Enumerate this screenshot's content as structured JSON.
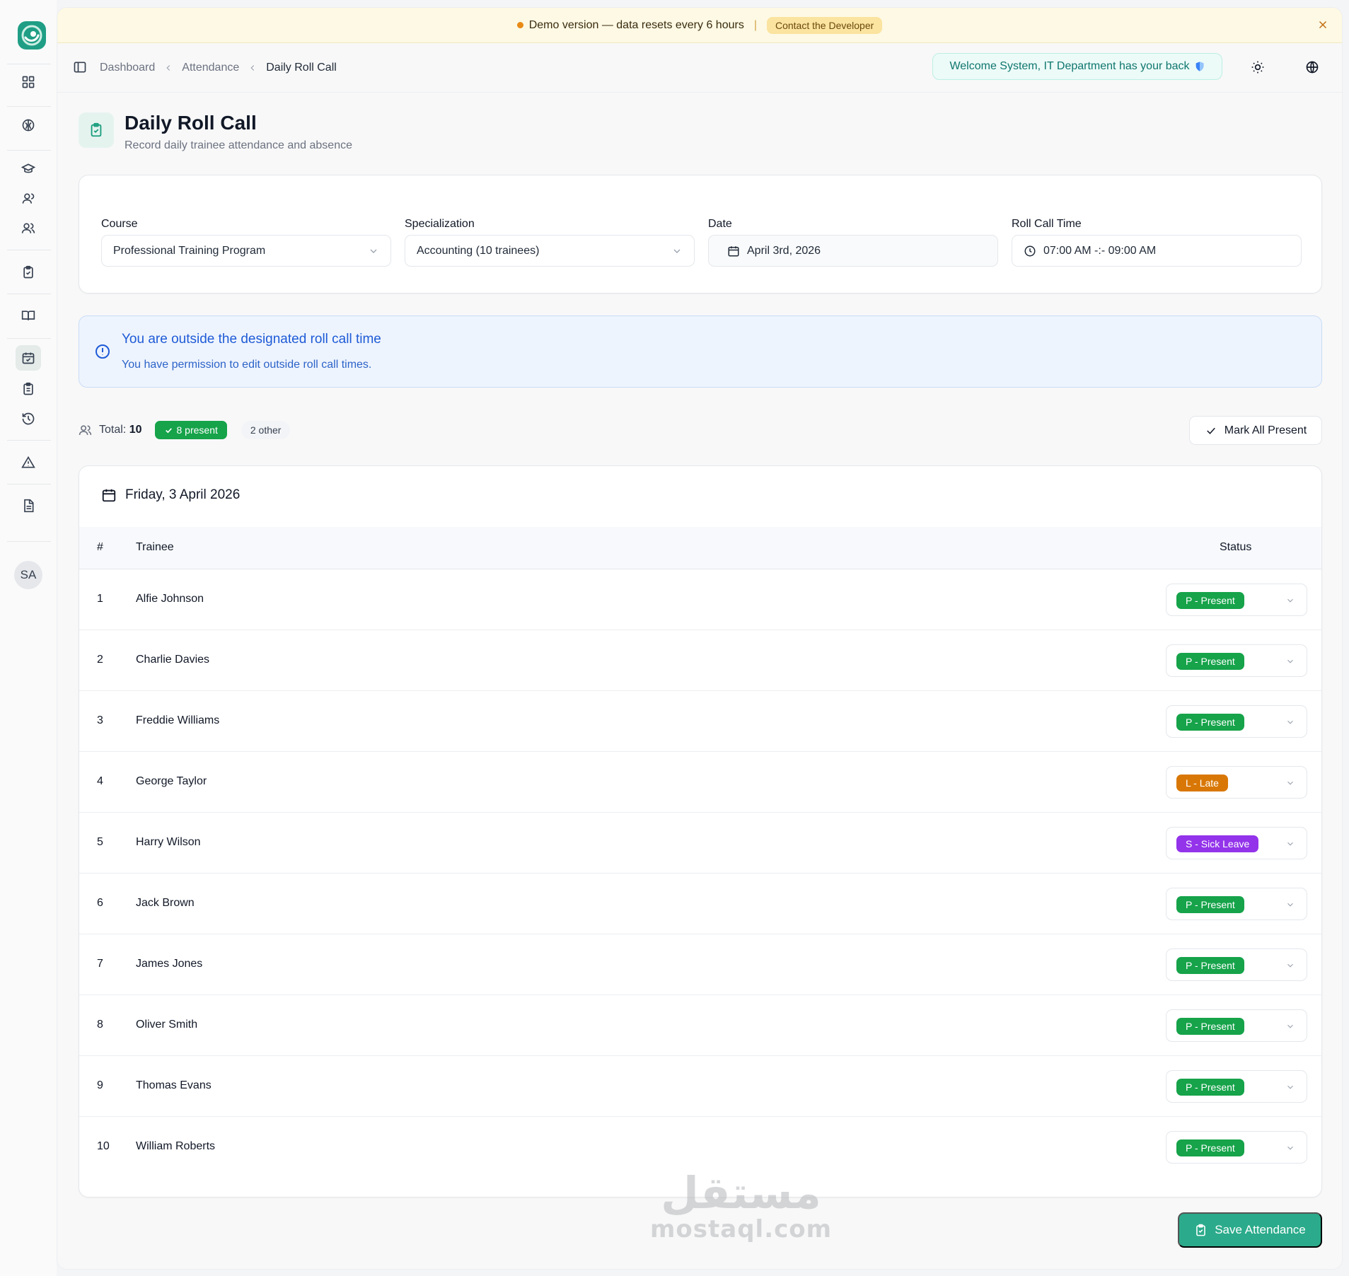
{
  "sidebar": {
    "avatar": "SA",
    "icons": [
      "dashboard-icon",
      "globe-brain-icon",
      "graduation-cap-icon",
      "user-icon",
      "users-icon",
      "clipboard-check-icon",
      "book-open-icon",
      "calendar-check-icon",
      "clipboard-list-icon",
      "history-icon",
      "alert-triangle-icon",
      "file-text-icon"
    ]
  },
  "banner": {
    "text": "Demo version — data resets every 6 hours",
    "separator": "|",
    "contact": "Contact the Developer",
    "accent": "#e88a16"
  },
  "breadcrumb": {
    "items": [
      "Dashboard",
      "Attendance"
    ],
    "current": "Daily Roll Call"
  },
  "welcome": {
    "text": "Welcome System, IT Department has your back",
    "icon": "shield-icon"
  },
  "page": {
    "title": "Daily Roll Call",
    "subtitle": "Record daily trainee attendance and absence"
  },
  "filters": {
    "course": {
      "label": "Course",
      "value": "Professional Training Program"
    },
    "specialization": {
      "label": "Specialization",
      "value": "Accounting (10 trainees)"
    },
    "date": {
      "label": "Date",
      "value": "April 3rd, 2026"
    },
    "time": {
      "label": "Roll Call Time",
      "value": "07:00 AM -:- 09:00 AM"
    }
  },
  "alert": {
    "title": "You are outside the designated roll call time",
    "description": "You have permission to edit outside roll call times."
  },
  "stats": {
    "total_label": "Total:",
    "total": "10",
    "present": "8 present",
    "other": "2 other"
  },
  "actions": {
    "mark_all": "Mark All Present",
    "save": "Save Attendance"
  },
  "table": {
    "date_heading": "Friday, 3 April 2026",
    "columns": {
      "num": "#",
      "trainee": "Trainee",
      "status": "Status"
    },
    "rows": [
      {
        "num": "1",
        "name": "Alfie Johnson",
        "status": "P - Present",
        "color": "#16a34a"
      },
      {
        "num": "2",
        "name": "Charlie Davies",
        "status": "P - Present",
        "color": "#16a34a"
      },
      {
        "num": "3",
        "name": "Freddie Williams",
        "status": "P - Present",
        "color": "#16a34a"
      },
      {
        "num": "4",
        "name": "George Taylor",
        "status": "L - Late",
        "color": "#d97706"
      },
      {
        "num": "5",
        "name": "Harry Wilson",
        "status": "S - Sick Leave",
        "color": "#9333ea"
      },
      {
        "num": "6",
        "name": "Jack Brown",
        "status": "P - Present",
        "color": "#16a34a"
      },
      {
        "num": "7",
        "name": "James Jones",
        "status": "P - Present",
        "color": "#16a34a"
      },
      {
        "num": "8",
        "name": "Oliver Smith",
        "status": "P - Present",
        "color": "#16a34a"
      },
      {
        "num": "9",
        "name": "Thomas Evans",
        "status": "P - Present",
        "color": "#16a34a"
      },
      {
        "num": "10",
        "name": "William Roberts",
        "status": "P - Present",
        "color": "#16a34a"
      }
    ]
  },
  "watermark": {
    "arabic": "مستقل",
    "latin": "mostaql.com"
  },
  "colors": {
    "brand": "#2bab8b",
    "info": "#1e5bd7"
  }
}
